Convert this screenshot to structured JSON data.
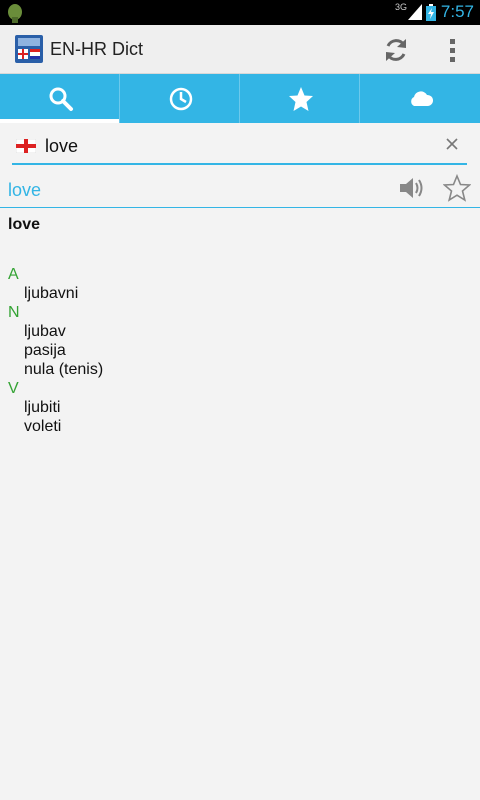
{
  "status_bar": {
    "time": "7:57",
    "network": "3G"
  },
  "app": {
    "title": "EN-HR Dict"
  },
  "tabs": [
    {
      "name": "search",
      "icon": "search-icon",
      "selected": true
    },
    {
      "name": "history",
      "icon": "clock-icon",
      "selected": false
    },
    {
      "name": "favorites",
      "icon": "star-icon",
      "selected": false
    },
    {
      "name": "cloud",
      "icon": "cloud-icon",
      "selected": false
    }
  ],
  "search": {
    "value": "love"
  },
  "result": {
    "headword": "love",
    "entry_word": "love",
    "sections": [
      {
        "pos": "A",
        "defs": [
          "ljubavni"
        ]
      },
      {
        "pos": "N",
        "defs": [
          "ljubav",
          "pasija",
          "nula (tenis)"
        ]
      },
      {
        "pos": "V",
        "defs": [
          "ljubiti",
          "voleti"
        ]
      }
    ]
  },
  "colors": {
    "accent": "#33b5e5",
    "pos": "#34a334"
  }
}
